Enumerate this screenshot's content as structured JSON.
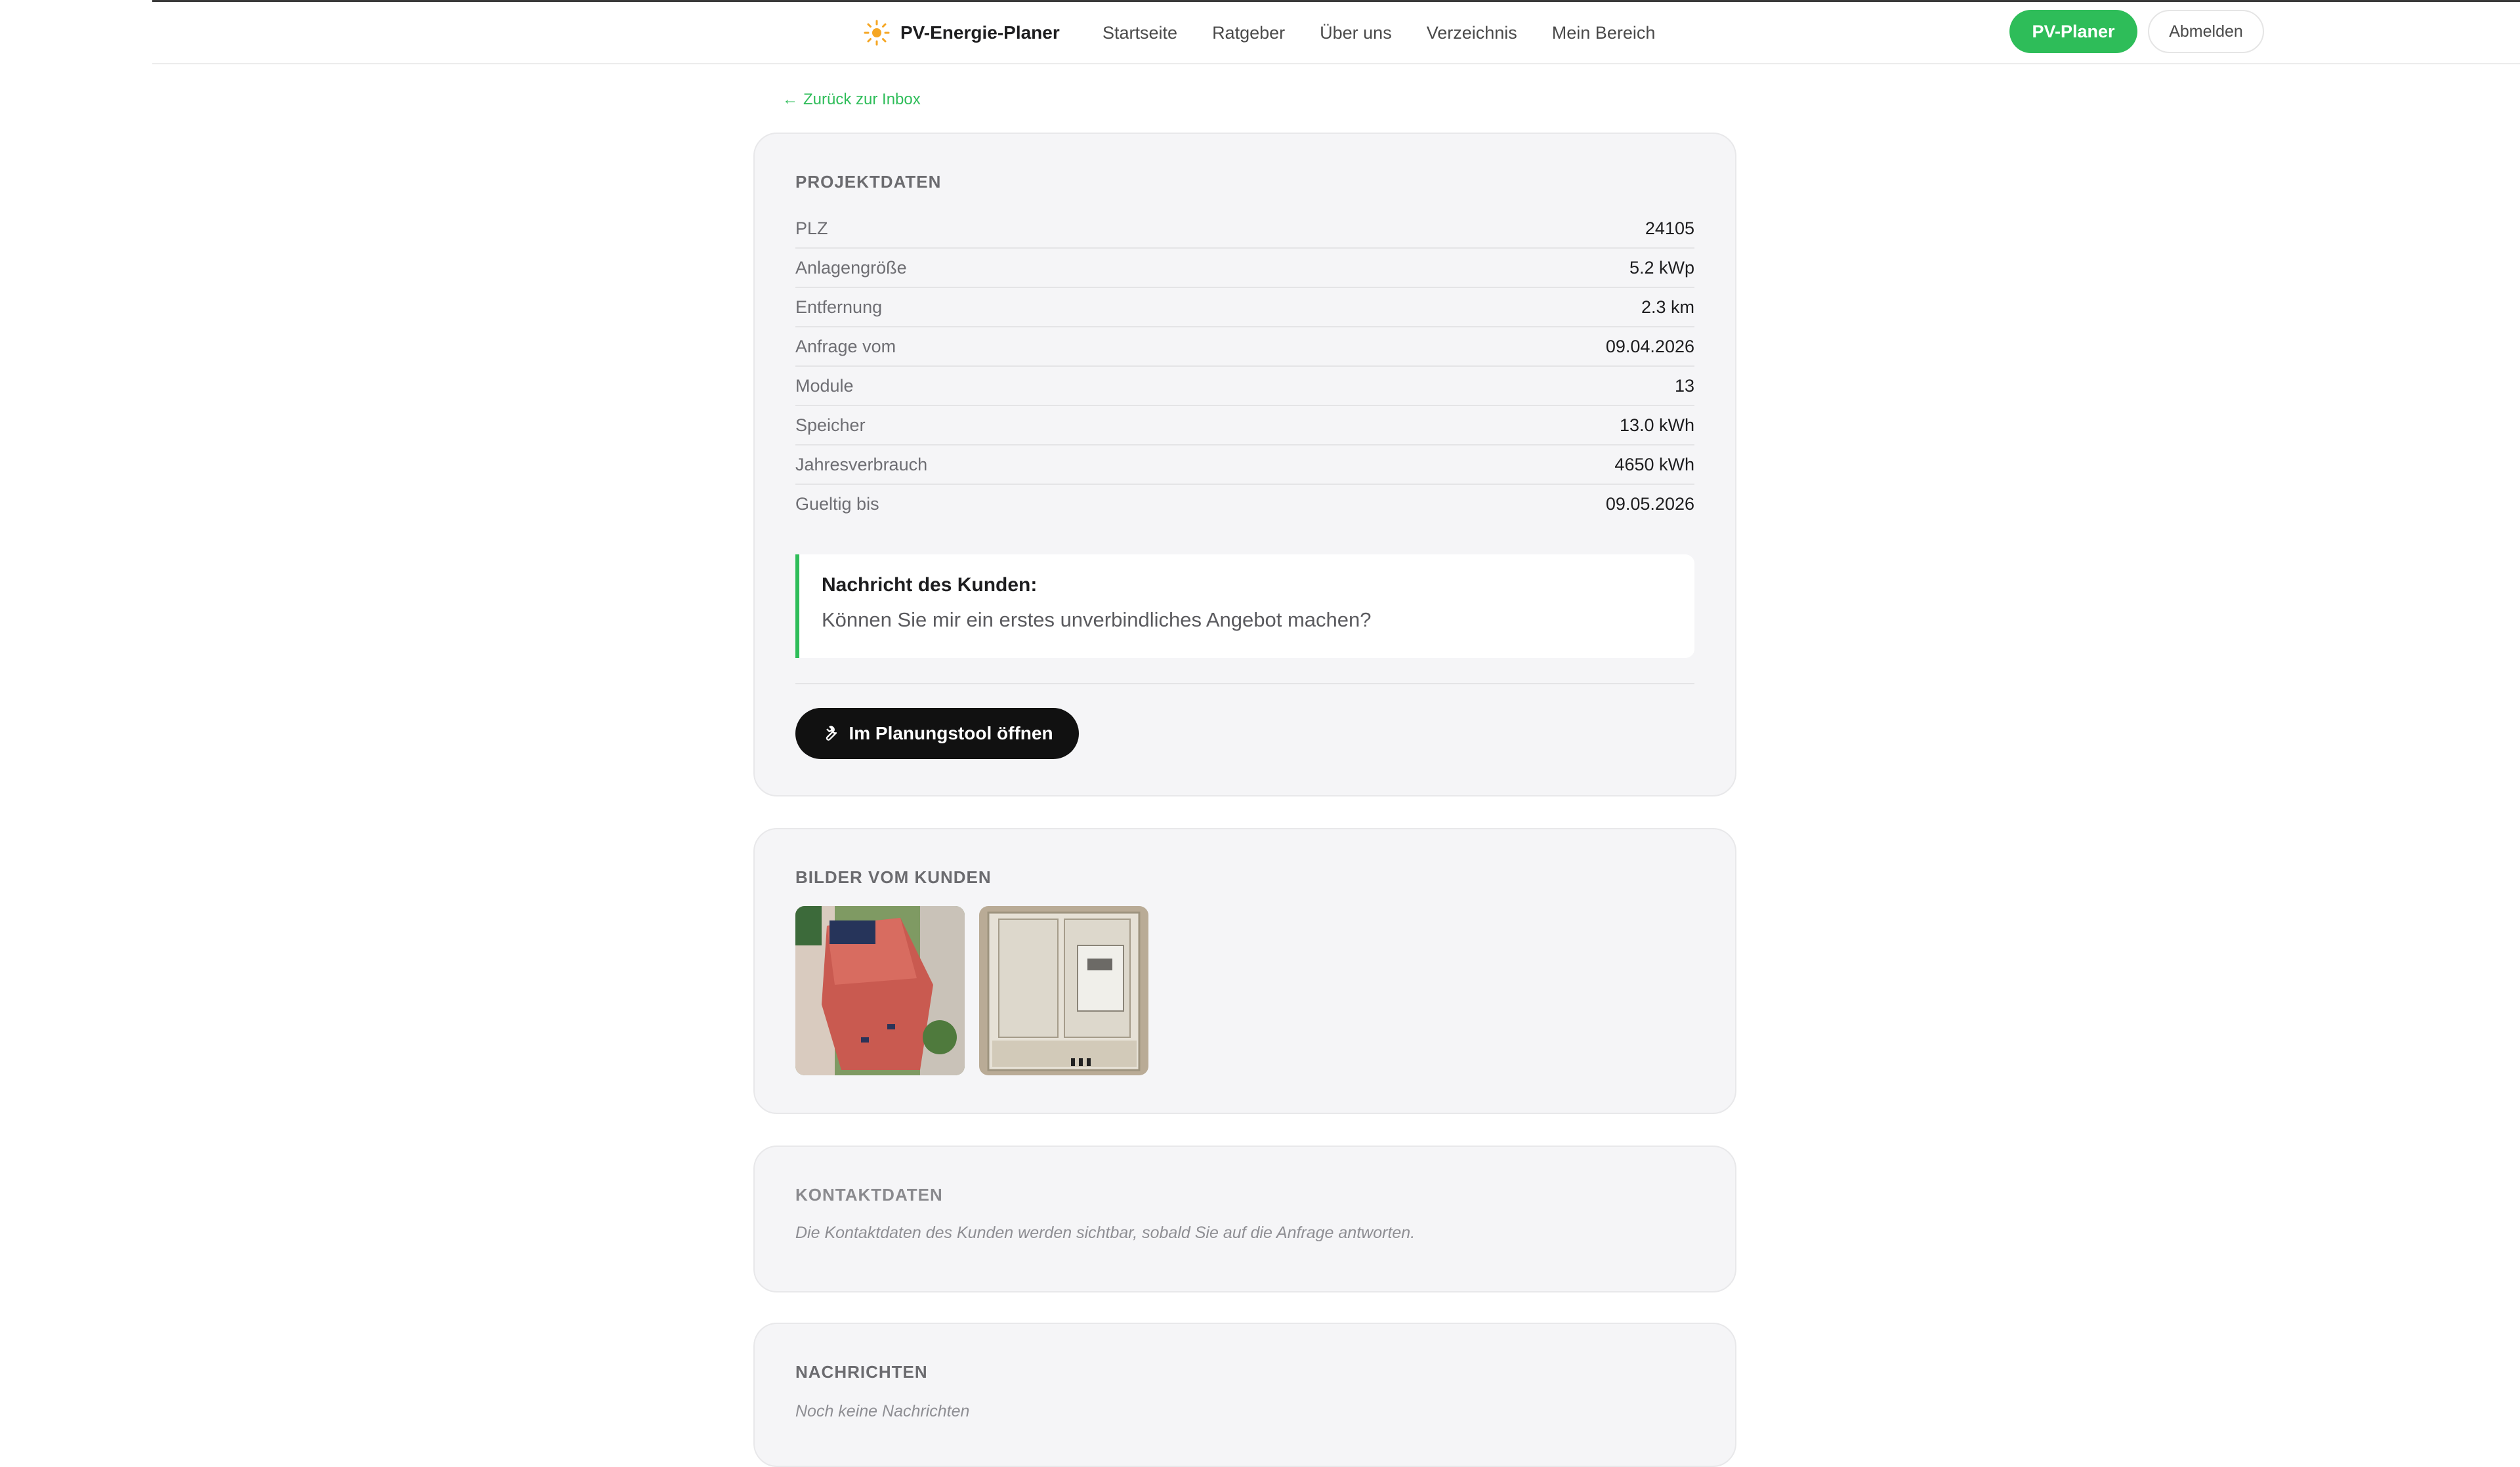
{
  "header": {
    "brand": "PV-Energie-Planer",
    "nav": [
      "Startseite",
      "Ratgeber",
      "Über uns",
      "Verzeichnis",
      "Mein Bereich"
    ],
    "primary_button": "PV-Planer",
    "logout_button": "Abmelden"
  },
  "back_link": "Zurück zur Inbox",
  "project": {
    "title": "PROJEKTDATEN",
    "rows": [
      {
        "label": "PLZ",
        "value": "24105"
      },
      {
        "label": "Anlagengröße",
        "value": "5.2 kWp"
      },
      {
        "label": "Entfernung",
        "value": "2.3 km"
      },
      {
        "label": "Anfrage vom",
        "value": "09.04.2026"
      },
      {
        "label": "Module",
        "value": "13"
      },
      {
        "label": "Speicher",
        "value": "13.0 kWh"
      },
      {
        "label": "Jahresverbrauch",
        "value": "4650 kWh"
      },
      {
        "label": "Gueltig bis",
        "value": "09.05.2026"
      }
    ],
    "message_title": "Nachricht des Kunden:",
    "message_body": "Können Sie mir ein erstes unverbindliches Angebot machen?",
    "tool_button": "Im Planungstool öffnen"
  },
  "images": {
    "title": "BILDER VOM KUNDEN"
  },
  "contact": {
    "title": "KONTAKTDATEN",
    "hint": "Die Kontaktdaten des Kunden werden sichtbar, sobald Sie auf die Anfrage antworten."
  },
  "messages": {
    "title": "NACHRICHTEN",
    "hint": "Noch keine Nachrichten"
  },
  "colors": {
    "accent": "#2ebd59",
    "dark_button": "#111111",
    "card_bg": "#f5f5f7"
  }
}
